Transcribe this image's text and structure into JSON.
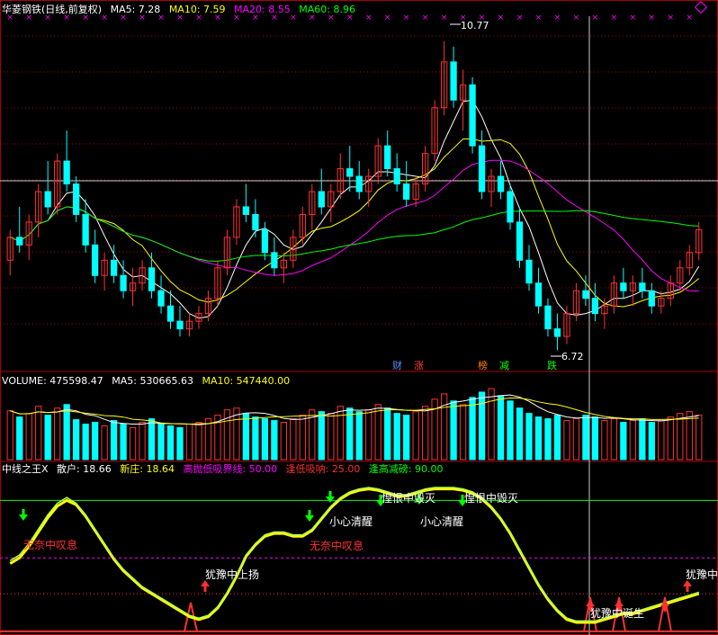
{
  "header": {
    "stock": "华菱钢铁(日线,前复权)",
    "ma5": "MA5: 7.28",
    "ma10": "MA10: 7.59",
    "ma20": "MA20: 8.55",
    "ma60": "MA60: 8.96"
  },
  "colors": {
    "up": "#ff3232",
    "down": "#00ffff",
    "ma5": "#ffffff",
    "ma10": "#ffff00",
    "ma20": "#ff00ff",
    "ma60": "#00ff00",
    "grid": "#aa0000",
    "border": "#aa0000"
  },
  "price_labels": {
    "high": "10.77",
    "low": "6.72"
  },
  "event_tags": [
    {
      "text": "财",
      "color": "#5a8cff"
    },
    {
      "text": "涨",
      "color": "#ff4040"
    },
    {
      "text": "榜",
      "color": "#ff8000"
    },
    {
      "text": "减",
      "color": "#00ff00"
    },
    {
      "text": "跌",
      "color": "#00ff00"
    }
  ],
  "volume_header": {
    "volume": "VOLUME: 475598.47",
    "ma5": "MA5: 530665.63",
    "ma10": "MA10: 547440.00"
  },
  "indicator_header": {
    "name": "中线之王X",
    "retail": "散户: 18.66",
    "new_dealer": "新庄: 18.64",
    "high_sell": "高抛低吸界线: 50.00",
    "low_buy": "逢低吸呐: 25.00",
    "high_reduce": "逢高减磅: 90.00"
  },
  "indicator_annotations": [
    {
      "text": "无奈中叹息",
      "color": "#ff3030"
    },
    {
      "text": "犹豫中上扬",
      "color": "#ffffff"
    },
    {
      "text": "小心清醒",
      "color": "#ffffff"
    },
    {
      "text": "无奈中叹息",
      "color": "#ff3030"
    },
    {
      "text": "惶恨中毁灭",
      "color": "#ffffff"
    },
    {
      "text": "小心清醒",
      "color": "#ffffff"
    },
    {
      "text": "惶恨中毁灭",
      "color": "#ffffff"
    },
    {
      "text": "犹豫中",
      "color": "#ffffff"
    },
    {
      "text": "犹豫中诞生",
      "color": "#ffffff"
    }
  ],
  "chart_data": {
    "type": "candlestick",
    "title": "华菱钢铁(日线,前复权)",
    "ylim": [
      6.5,
      11.1
    ],
    "candles": [
      [
        7.9,
        8.3,
        7.7,
        8.2
      ],
      [
        8.2,
        8.6,
        8.0,
        8.1
      ],
      [
        8.1,
        8.5,
        7.9,
        8.4
      ],
      [
        8.4,
        8.9,
        8.2,
        8.8
      ],
      [
        8.8,
        9.2,
        8.5,
        8.6
      ],
      [
        8.6,
        9.3,
        8.5,
        9.2
      ],
      [
        9.2,
        9.6,
        8.8,
        8.9
      ],
      [
        8.9,
        9.0,
        8.4,
        8.5
      ],
      [
        8.5,
        8.7,
        8.0,
        8.1
      ],
      [
        8.1,
        8.3,
        7.6,
        7.7
      ],
      [
        7.7,
        8.0,
        7.5,
        7.9
      ],
      [
        7.9,
        8.1,
        7.6,
        7.7
      ],
      [
        7.7,
        7.9,
        7.4,
        7.5
      ],
      [
        7.5,
        7.8,
        7.3,
        7.6
      ],
      [
        7.6,
        7.9,
        7.5,
        7.8
      ],
      [
        7.8,
        8.0,
        7.4,
        7.5
      ],
      [
        7.5,
        7.7,
        7.2,
        7.3
      ],
      [
        7.3,
        7.5,
        7.0,
        7.1
      ],
      [
        7.1,
        7.3,
        6.9,
        7.0
      ],
      [
        7.0,
        7.2,
        6.9,
        7.1
      ],
      [
        7.1,
        7.3,
        7.0,
        7.2
      ],
      [
        7.2,
        7.5,
        7.1,
        7.4
      ],
      [
        7.4,
        7.9,
        7.3,
        7.8
      ],
      [
        7.8,
        8.3,
        7.7,
        8.2
      ],
      [
        8.2,
        8.7,
        8.1,
        8.6
      ],
      [
        8.6,
        8.9,
        8.4,
        8.5
      ],
      [
        8.5,
        8.7,
        8.2,
        8.3
      ],
      [
        8.3,
        8.4,
        7.9,
        8.0
      ],
      [
        8.0,
        8.2,
        7.7,
        7.8
      ],
      [
        7.8,
        8.0,
        7.6,
        7.9
      ],
      [
        7.9,
        8.3,
        7.8,
        8.2
      ],
      [
        8.2,
        8.6,
        8.1,
        8.5
      ],
      [
        8.5,
        8.9,
        8.3,
        8.8
      ],
      [
        8.8,
        9.1,
        8.5,
        8.6
      ],
      [
        8.6,
        8.9,
        8.4,
        8.8
      ],
      [
        8.8,
        9.3,
        8.7,
        9.1
      ],
      [
        9.1,
        9.4,
        8.8,
        9.0
      ],
      [
        9.0,
        9.2,
        8.7,
        8.8
      ],
      [
        8.8,
        9.1,
        8.6,
        9.0
      ],
      [
        9.0,
        9.5,
        8.9,
        9.4
      ],
      [
        9.4,
        9.6,
        9.0,
        9.1
      ],
      [
        9.1,
        9.3,
        8.8,
        8.9
      ],
      [
        8.9,
        9.2,
        8.6,
        8.7
      ],
      [
        8.7,
        9.0,
        8.6,
        8.9
      ],
      [
        8.9,
        9.4,
        8.8,
        9.3
      ],
      [
        9.3,
        10.0,
        9.2,
        9.9
      ],
      [
        9.9,
        10.77,
        9.8,
        10.5
      ],
      [
        10.5,
        10.7,
        9.9,
        10.0
      ],
      [
        10.0,
        10.4,
        9.6,
        10.2
      ],
      [
        10.2,
        10.3,
        9.3,
        9.4
      ],
      [
        9.4,
        9.6,
        8.7,
        8.8
      ],
      [
        8.8,
        9.1,
        8.6,
        9.0
      ],
      [
        9.0,
        9.2,
        8.7,
        8.8
      ],
      [
        8.8,
        8.9,
        8.3,
        8.4
      ],
      [
        8.4,
        8.6,
        7.8,
        7.9
      ],
      [
        7.9,
        8.1,
        7.5,
        7.6
      ],
      [
        7.6,
        7.8,
        7.2,
        7.3
      ],
      [
        7.3,
        7.4,
        6.9,
        7.0
      ],
      [
        7.0,
        7.2,
        6.72,
        6.9
      ],
      [
        6.9,
        7.3,
        6.8,
        7.2
      ],
      [
        7.2,
        7.6,
        7.1,
        7.5
      ],
      [
        7.5,
        7.7,
        7.3,
        7.4
      ],
      [
        7.4,
        7.6,
        7.1,
        7.2
      ],
      [
        7.2,
        7.4,
        7.0,
        7.3
      ],
      [
        7.3,
        7.7,
        7.2,
        7.6
      ],
      [
        7.6,
        7.8,
        7.4,
        7.5
      ],
      [
        7.5,
        7.7,
        7.3,
        7.6
      ],
      [
        7.6,
        7.8,
        7.4,
        7.5
      ],
      [
        7.5,
        7.6,
        7.2,
        7.3
      ],
      [
        7.3,
        7.5,
        7.2,
        7.4
      ],
      [
        7.4,
        7.7,
        7.3,
        7.6
      ],
      [
        7.6,
        7.9,
        7.5,
        7.8
      ],
      [
        7.8,
        8.1,
        7.7,
        8.0
      ],
      [
        8.0,
        8.4,
        7.9,
        8.3
      ]
    ],
    "volume": [
      55,
      48,
      52,
      60,
      50,
      58,
      62,
      45,
      40,
      42,
      38,
      44,
      40,
      36,
      42,
      46,
      40,
      38,
      36,
      40,
      42,
      46,
      50,
      56,
      58,
      52,
      48,
      46,
      44,
      42,
      46,
      50,
      56,
      54,
      52,
      60,
      58,
      54,
      56,
      62,
      58,
      52,
      50,
      54,
      60,
      68,
      74,
      66,
      62,
      70,
      76,
      80,
      72,
      66,
      58,
      52,
      48,
      46,
      50,
      44,
      46,
      50,
      48,
      44,
      46,
      42,
      44,
      46,
      42,
      44,
      48,
      52,
      54,
      50
    ],
    "volume_ylim": [
      0,
      80
    ],
    "indicator": {
      "ylim": [
        0,
        100
      ],
      "levels": {
        "high_reduce": 90.0,
        "high_sell": 50.0,
        "low_buy": 25.0
      },
      "retail": [
        48,
        52,
        60,
        70,
        80,
        88,
        92,
        88,
        80,
        70,
        60,
        50,
        42,
        36,
        30,
        26,
        22,
        18,
        14,
        10,
        8,
        10,
        16,
        26,
        38,
        52,
        60,
        66,
        68,
        68,
        66,
        66,
        70,
        78,
        86,
        92,
        96,
        98,
        99,
        98,
        96,
        94,
        94,
        96,
        98,
        99,
        99,
        99,
        98,
        96,
        92,
        86,
        78,
        68,
        56,
        44,
        32,
        22,
        14,
        8,
        6,
        6,
        6,
        8,
        10,
        12,
        12,
        14,
        16,
        18,
        20,
        22,
        24,
        26
      ],
      "new_dealer": [
        46,
        50,
        58,
        68,
        78,
        86,
        90,
        87,
        79,
        69,
        59,
        49,
        41,
        35,
        29,
        25,
        21,
        17,
        13,
        9,
        7,
        9,
        15,
        25,
        37,
        51,
        59,
        65,
        67,
        67,
        65,
        65,
        69,
        77,
        85,
        91,
        95,
        97,
        98,
        97,
        95,
        93,
        93,
        95,
        97,
        98,
        98,
        98,
        97,
        95,
        91,
        85,
        77,
        67,
        55,
        43,
        31,
        21,
        13,
        7,
        5,
        5,
        5,
        7,
        9,
        11,
        11,
        13,
        15,
        17,
        19,
        21,
        23,
        25
      ]
    }
  }
}
